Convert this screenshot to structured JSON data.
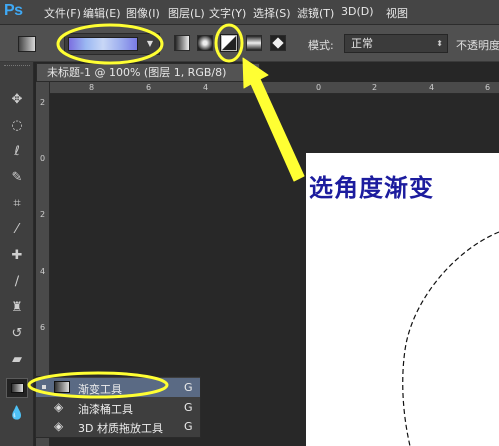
{
  "app": {
    "logo": "Ps"
  },
  "menu": [
    "文件(F)",
    "编辑(E)",
    "图像(I)",
    "图层(L)",
    "文字(Y)",
    "选择(S)",
    "滤镜(T)",
    "3D(D)",
    "视图"
  ],
  "options_bar": {
    "mode_label": "模式:",
    "mode_value": "正常",
    "opacity_label": "不透明度"
  },
  "document": {
    "tab_title": "未标题-1 @ 100% (图层 1, RGB/8)",
    "close_glyph": "×"
  },
  "rulers": {
    "top": [
      "8",
      "6",
      "4",
      "2",
      "0",
      "2",
      "4",
      "6"
    ],
    "left": [
      "2",
      "0",
      "2",
      "4",
      "6"
    ]
  },
  "annotation": {
    "text": "选角度渐变"
  },
  "flyout": {
    "items": [
      {
        "label": "渐变工具",
        "shortcut": "G",
        "active": true
      },
      {
        "label": "油漆桶工具",
        "shortcut": "G",
        "active": false
      },
      {
        "label": "3D 材质拖放工具",
        "shortcut": "G",
        "active": false
      }
    ]
  },
  "colors": {
    "highlight": "#ffff33",
    "annotation_text": "#1c1c9e",
    "accent": "#3fa9f5"
  }
}
